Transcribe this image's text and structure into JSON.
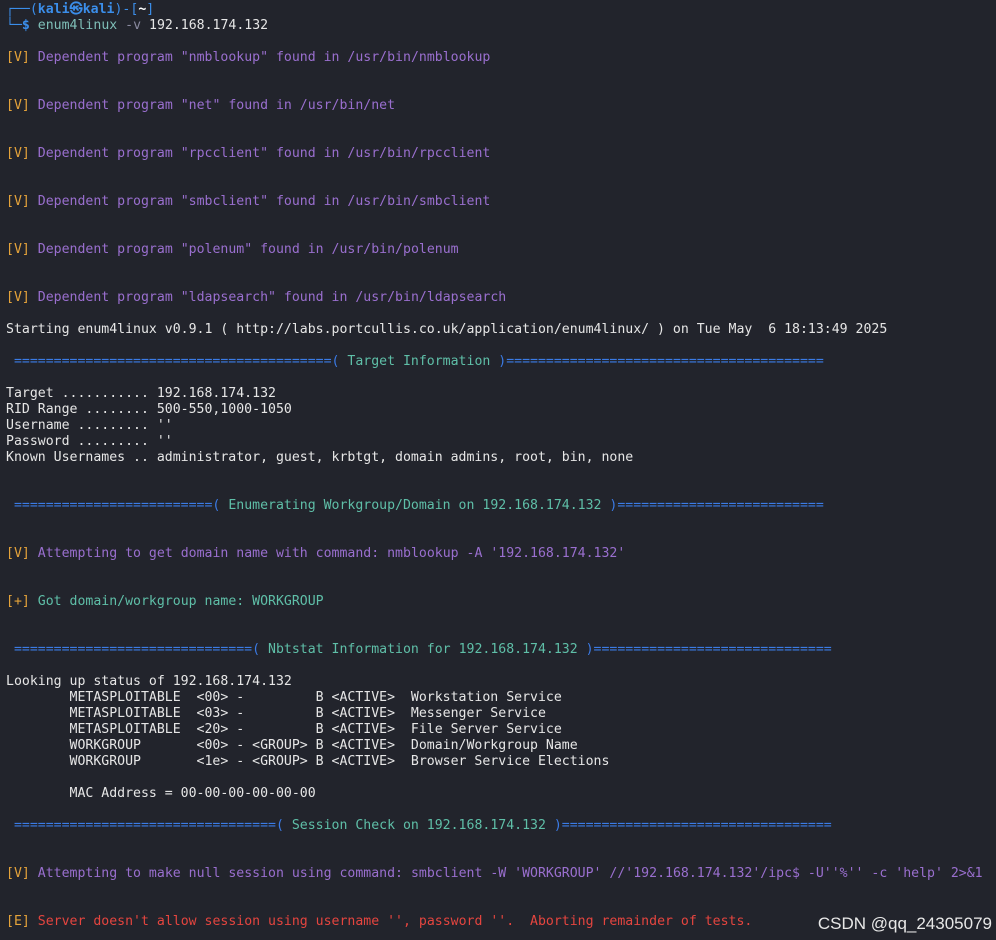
{
  "prompt": {
    "corner_top": "┌──(",
    "user": "kali",
    "skull": "㉿",
    "host": "kali",
    "close_open": ")-[",
    "cwd": "~",
    "close": "]",
    "corner_bottom": "└─",
    "dollar": "$",
    "command": "enum4linux",
    "flag": "-v",
    "argument": "192.168.174.132"
  },
  "dependents": [
    {
      "tag": "[V]",
      "text": "Dependent program \"nmblookup\" found in /usr/bin/nmblookup"
    },
    {
      "tag": "[V]",
      "text": "Dependent program \"net\" found in /usr/bin/net"
    },
    {
      "tag": "[V]",
      "text": "Dependent program \"rpcclient\" found in /usr/bin/rpcclient"
    },
    {
      "tag": "[V]",
      "text": "Dependent program \"smbclient\" found in /usr/bin/smbclient"
    },
    {
      "tag": "[V]",
      "text": "Dependent program \"polenum\" found in /usr/bin/polenum"
    },
    {
      "tag": "[V]",
      "text": "Dependent program \"ldapsearch\" found in /usr/bin/ldapsearch"
    }
  ],
  "starting_line": "Starting enum4linux v0.9.1 ( http://labs.portcullis.co.uk/application/enum4linux/ ) on Tue May  6 18:13:49 2025",
  "sections": {
    "target": {
      "left": " ========================================( ",
      "title": "Target Information",
      "right": " )========================================"
    },
    "workgroup": {
      "left": " =========================( ",
      "title": "Enumerating Workgroup/Domain on 192.168.174.132",
      "right": " )=========================="
    },
    "nbtstat": {
      "left": " ==============================( ",
      "title": "Nbtstat Information for 192.168.174.132",
      "right": " )=============================="
    },
    "session": {
      "left": " =================================( ",
      "title": "Session Check on 192.168.174.132",
      "right": " )=================================="
    }
  },
  "target_info": [
    "Target ........... 192.168.174.132",
    "RID Range ........ 500-550,1000-1050",
    "Username ......... ''",
    "Password ......... ''",
    "Known Usernames .. administrator, guest, krbtgt, domain admins, root, bin, none"
  ],
  "workgroup_lines": {
    "v_tag": "[V]",
    "v_text": "Attempting to get domain name with command: nmblookup -A '192.168.174.132'",
    "plus_tag": "[+]",
    "plus_text": "Got domain/workgroup name: WORKGROUP"
  },
  "nbtstat_lines": [
    "Looking up status of 192.168.174.132",
    "        METASPLOITABLE  <00> -         B <ACTIVE>  Workstation Service",
    "        METASPLOITABLE  <03> -         B <ACTIVE>  Messenger Service",
    "        METASPLOITABLE  <20> -         B <ACTIVE>  File Server Service",
    "        WORKGROUP       <00> - <GROUP> B <ACTIVE>  Domain/Workgroup Name",
    "        WORKGROUP       <1e> - <GROUP> B <ACTIVE>  Browser Service Elections",
    "",
    "        MAC Address = 00-00-00-00-00-00"
  ],
  "session_lines": {
    "v_tag": "[V]",
    "v_text": "Attempting to make null session using command: smbclient -W 'WORKGROUP' //'192.168.174.132'/ipc$ -U''%'' -c 'help' 2>&1",
    "e_tag": "[E]",
    "e_text": "Server doesn't allow session using username '', password ''.  Aborting remainder of tests."
  },
  "watermark": "CSDN @qq_24305079",
  "colors": {
    "background": "#22242c",
    "verbose_text": "#9a6fcf",
    "tag": "#e5a33a",
    "section_bar": "#3b7be6",
    "section_title": "#5fbfa8",
    "error_text": "#e5453f"
  }
}
